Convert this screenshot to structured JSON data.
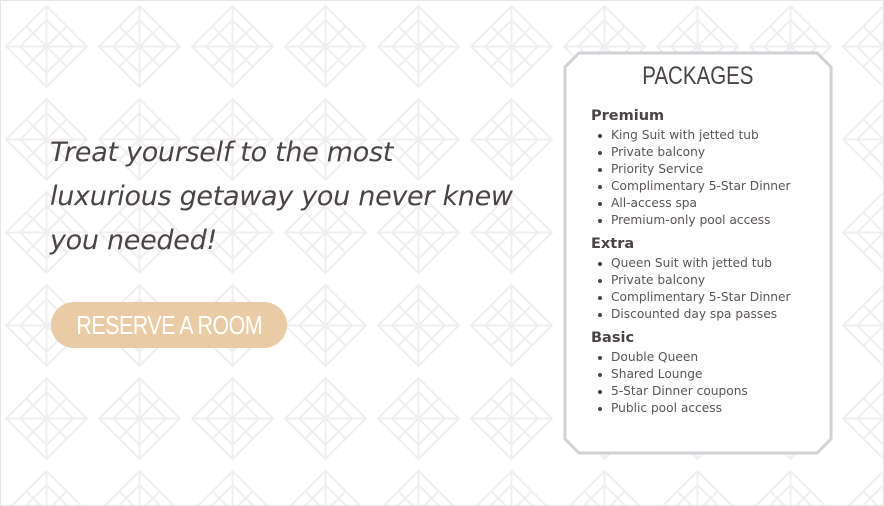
{
  "tagline": "Treat yourself to the most luxurious getaway you never knew you needed!",
  "reserve_button": {
    "label": "RESERVE A ROOM",
    "color": "#e9cca6"
  },
  "packages": {
    "title": "PACKAGES",
    "tiers": [
      {
        "name": "Premium",
        "items": [
          "King Suit with jetted tub",
          "Private balcony",
          "Priority Service",
          "Complimentary 5-Star Dinner",
          "All-access spa",
          "Premium-only pool access"
        ]
      },
      {
        "name": "Extra",
        "items": [
          "Queen Suit with jetted tub",
          "Private balcony",
          "Complimentary 5-Star Dinner",
          "Discounted day spa passes"
        ]
      },
      {
        "name": "Basic",
        "items": [
          "Double Queen",
          "Shared Lounge",
          "5-Star Dinner coupons",
          "Public pool access"
        ]
      }
    ]
  },
  "colors": {
    "text": "#4a4448",
    "card_border": "#d0d2d6",
    "pattern": "#f1f0f2"
  }
}
